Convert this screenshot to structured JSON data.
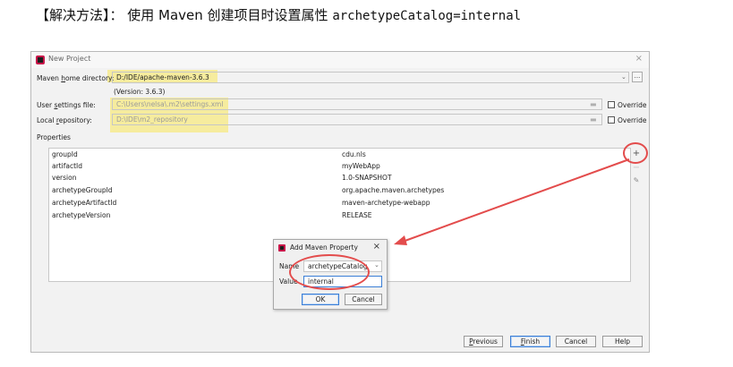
{
  "heading": {
    "prefix": "【解决方法】：  使用 Maven 创建项目时设置属性 ",
    "code": "archetypeCatalog=internal"
  },
  "window": {
    "title": "New Project",
    "close_glyph": "×"
  },
  "maven_home": {
    "label_pre": "Maven ",
    "label_u": "h",
    "label_post": "ome directory:",
    "value": "D:/IDE/apache-maven-3.6.3",
    "version": "(Version: 3.6.3)"
  },
  "user_settings": {
    "label_pre": "User ",
    "label_u": "s",
    "label_post": "ettings file:",
    "value": "C:\\Users\\nelsa\\.m2\\settings.xml",
    "override": "Override"
  },
  "local_repo": {
    "label_pre": "Local ",
    "label_u": "r",
    "label_post": "epository:",
    "value": "D:\\IDE\\m2_repository",
    "override": "Override"
  },
  "properties": {
    "label": "Properties",
    "rows": [
      {
        "key": "groupId",
        "value": "cdu.nls"
      },
      {
        "key": "artifactId",
        "value": "myWebApp"
      },
      {
        "key": "version",
        "value": "1.0-SNAPSHOT"
      },
      {
        "key": "archetypeGroupId",
        "value": "org.apache.maven.archetypes"
      },
      {
        "key": "archetypeArtifactId",
        "value": "maven-archetype-webapp"
      },
      {
        "key": "archetypeVersion",
        "value": "RELEASE"
      }
    ],
    "add": "+",
    "remove": "−",
    "edit": "✎"
  },
  "dialog": {
    "title": "Add Maven Property",
    "close_glyph": "×",
    "name_label": "Name",
    "name_value": "archetypeCatalog",
    "value_label": "Value",
    "value_value": "internal",
    "ok": "OK",
    "cancel": "Cancel"
  },
  "footer": {
    "previous_u": "P",
    "previous_rest": "revious",
    "finish_u": "F",
    "finish_rest": "inish",
    "cancel": "Cancel",
    "help": "Help"
  },
  "colors": {
    "highlight": "#fae85a",
    "annotation": "#e34c4c",
    "focus": "#3c7fd6"
  }
}
